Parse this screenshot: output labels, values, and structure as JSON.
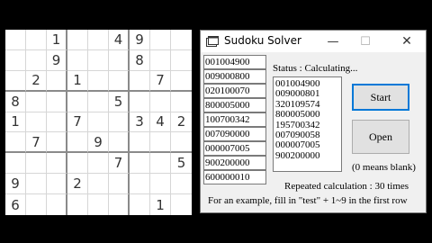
{
  "board": {
    "rows": [
      [
        "",
        "",
        "1",
        "",
        "",
        "4",
        "9",
        "",
        ""
      ],
      [
        "",
        "",
        "9",
        "",
        "",
        "",
        "8",
        "",
        ""
      ],
      [
        "",
        "2",
        "",
        "1",
        "",
        "",
        "",
        "7",
        ""
      ],
      [
        "8",
        "",
        "",
        "",
        "",
        "5",
        "",
        "",
        ""
      ],
      [
        "1",
        "",
        "",
        "7",
        "",
        "",
        "3",
        "4",
        "2"
      ],
      [
        "",
        "7",
        "",
        "",
        "9",
        "",
        "",
        "",
        ""
      ],
      [
        "",
        "",
        "",
        "",
        "",
        "7",
        "",
        "",
        "5"
      ],
      [
        "9",
        "",
        "",
        "2",
        "",
        "",
        "",
        "",
        ""
      ],
      [
        "6",
        "",
        "",
        "",
        "",
        "",
        "",
        "1",
        ""
      ]
    ]
  },
  "window": {
    "title": "Sudoku Solver",
    "minimize_glyph": "—",
    "maximize_glyph": "☐",
    "close_glyph": "✕",
    "app_icon": "folder-window-icon"
  },
  "inputs": [
    "001004900",
    "009000800",
    "020100070",
    "800005000",
    "100700342",
    "007090000",
    "000007005",
    "900200000",
    "600000010"
  ],
  "status_text": "Status : Calculating...",
  "results": [
    "001004900",
    "009000801",
    "320109574",
    "800005000",
    "195700342",
    "007090058",
    "000007005",
    "900200000"
  ],
  "buttons": {
    "start": "Start",
    "open": "Open"
  },
  "hint": "(0 means blank)",
  "repeat_text": "Repeated calculation : 30 times",
  "example_text": "For an example, fill in \"test\" + 1~9 in the first row",
  "colors": {
    "focus_border": "#0078d7",
    "button_bg": "#e1e1e1",
    "window_bg": "#f0f0f0"
  }
}
